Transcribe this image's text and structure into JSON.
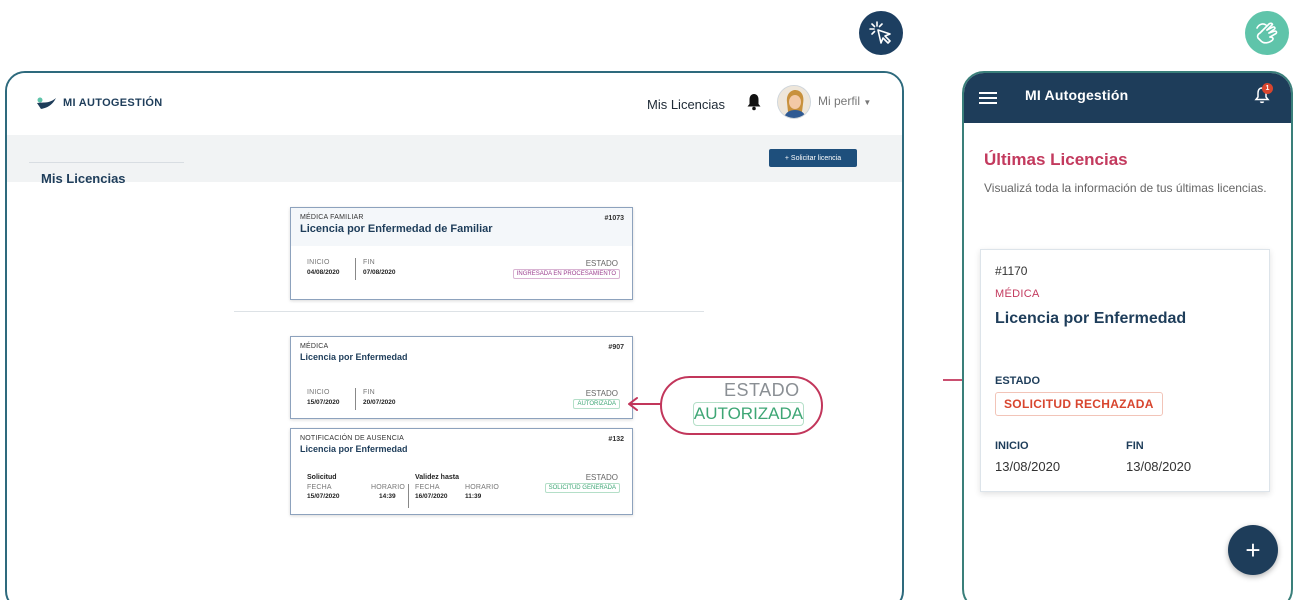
{
  "desktop": {
    "logo_text": "MI AUTOGESTIÓN",
    "nav_link": "Mis Licencias",
    "profile_label": "Mi perfil",
    "sidebar_title": "Mis Licencias",
    "request_button": "+ Solicitar licencia",
    "cards": [
      {
        "category": "MÉDICA FAMILIAR",
        "number": "#1073",
        "title": "Licencia por Enfermedad de Familiar",
        "start_label": "INICIO",
        "start_value": "04/08/2020",
        "end_label": "FIN",
        "end_value": "07/08/2020",
        "status_label": "ESTADO",
        "status_value": "INGRESADA EN PROCESAMIENTO"
      },
      {
        "category": "MÉDICA",
        "number": "#907",
        "title": "Licencia por Enfermedad",
        "start_label": "INICIO",
        "start_value": "15/07/2020",
        "end_label": "FIN",
        "end_value": "20/07/2020",
        "status_label": "ESTADO",
        "status_value": "AUTORIZADA"
      },
      {
        "category": "NOTIFICACIÓN DE AUSENCIA",
        "number": "#132",
        "title": "Licencia por Enfermedad",
        "solicitud_label": "Solicitud",
        "validez_label": "Validez hasta",
        "fecha_label": "FECHA",
        "horario_label": "HORARIO",
        "sol_fecha": "15/07/2020",
        "sol_horario": "14:39",
        "val_fecha": "16/07/2020",
        "val_horario": "11:39",
        "status_label": "ESTADO",
        "status_value": "SOLICITUD GENERADA"
      }
    ],
    "callout": {
      "label": "ESTADO",
      "value": "AUTORIZADA"
    }
  },
  "mobile": {
    "app_title": "MI Autogestión",
    "notification_count": "1",
    "section_title": "Últimas Licencias",
    "section_desc": "Visualizá toda la información de tus últimas licencias.",
    "card": {
      "number": "#1170",
      "category": "MÉDICA",
      "title": "Licencia por Enfermedad",
      "status_label": "ESTADO",
      "status_value": "SOLICITUD RECHAZADA",
      "start_label": "INICIO",
      "start_value": "13/08/2020",
      "end_label": "FIN",
      "end_value": "13/08/2020"
    },
    "fab_label": "+"
  },
  "colors": {
    "navy": "#1e3d5a",
    "teal": "#5fc4aa",
    "crimson": "#c2365b",
    "green": "#3ea675",
    "purple": "#9b3f8f",
    "red": "#d8452e"
  },
  "icons": [
    "cursor-click-icon",
    "hand-tap-icon",
    "bell-icon",
    "hamburger-icon",
    "arrow-left-icon",
    "arrow-right-icon"
  ]
}
